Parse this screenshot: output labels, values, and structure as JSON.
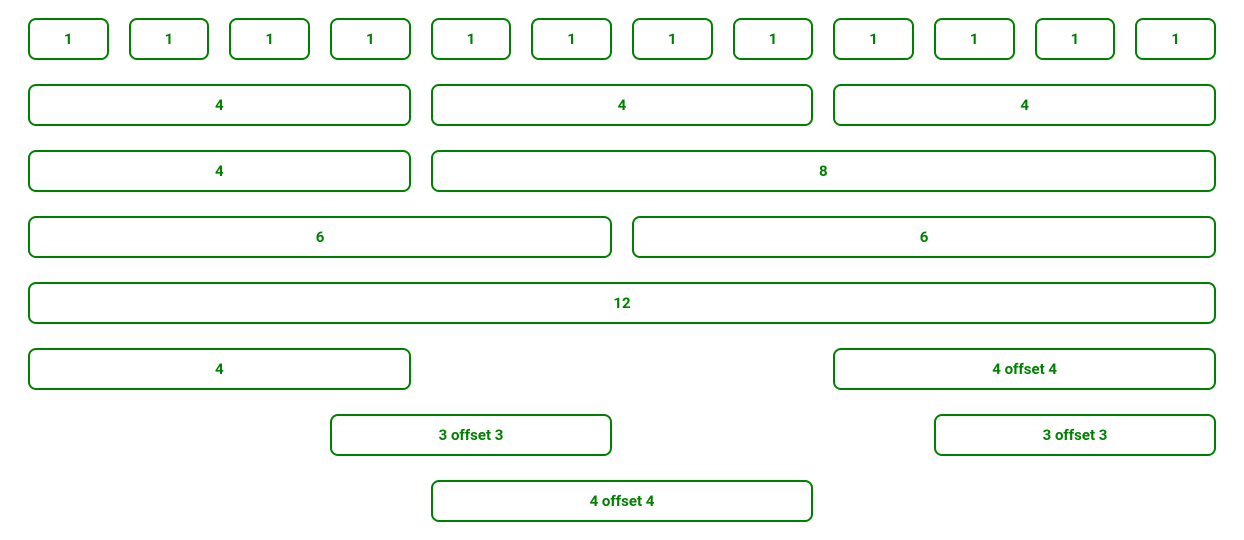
{
  "grid": {
    "rows": [
      {
        "cols": [
          {
            "span": 1,
            "label": "1"
          },
          {
            "span": 1,
            "label": "1"
          },
          {
            "span": 1,
            "label": "1"
          },
          {
            "span": 1,
            "label": "1"
          },
          {
            "span": 1,
            "label": "1"
          },
          {
            "span": 1,
            "label": "1"
          },
          {
            "span": 1,
            "label": "1"
          },
          {
            "span": 1,
            "label": "1"
          },
          {
            "span": 1,
            "label": "1"
          },
          {
            "span": 1,
            "label": "1"
          },
          {
            "span": 1,
            "label": "1"
          },
          {
            "span": 1,
            "label": "1"
          }
        ]
      },
      {
        "cols": [
          {
            "span": 4,
            "label": "4"
          },
          {
            "span": 4,
            "label": "4"
          },
          {
            "span": 4,
            "label": "4"
          }
        ]
      },
      {
        "cols": [
          {
            "span": 4,
            "label": "4"
          },
          {
            "span": 8,
            "label": "8"
          }
        ]
      },
      {
        "cols": [
          {
            "span": 6,
            "label": "6"
          },
          {
            "span": 6,
            "label": "6"
          }
        ]
      },
      {
        "cols": [
          {
            "span": 12,
            "label": "12"
          }
        ]
      },
      {
        "cols": [
          {
            "span": 4,
            "label": "4"
          },
          {
            "span": 4,
            "offset": 4,
            "label": "4 offset 4"
          }
        ]
      },
      {
        "cols": [
          {
            "span": 3,
            "offset": 3,
            "label": "3 offset 3"
          },
          {
            "span": 3,
            "offset": 3,
            "label": "3 offset 3"
          }
        ]
      },
      {
        "cols": [
          {
            "span": 4,
            "offset": 4,
            "label": "4 offset 4"
          }
        ]
      }
    ]
  },
  "colors": {
    "accent": "#008000"
  }
}
